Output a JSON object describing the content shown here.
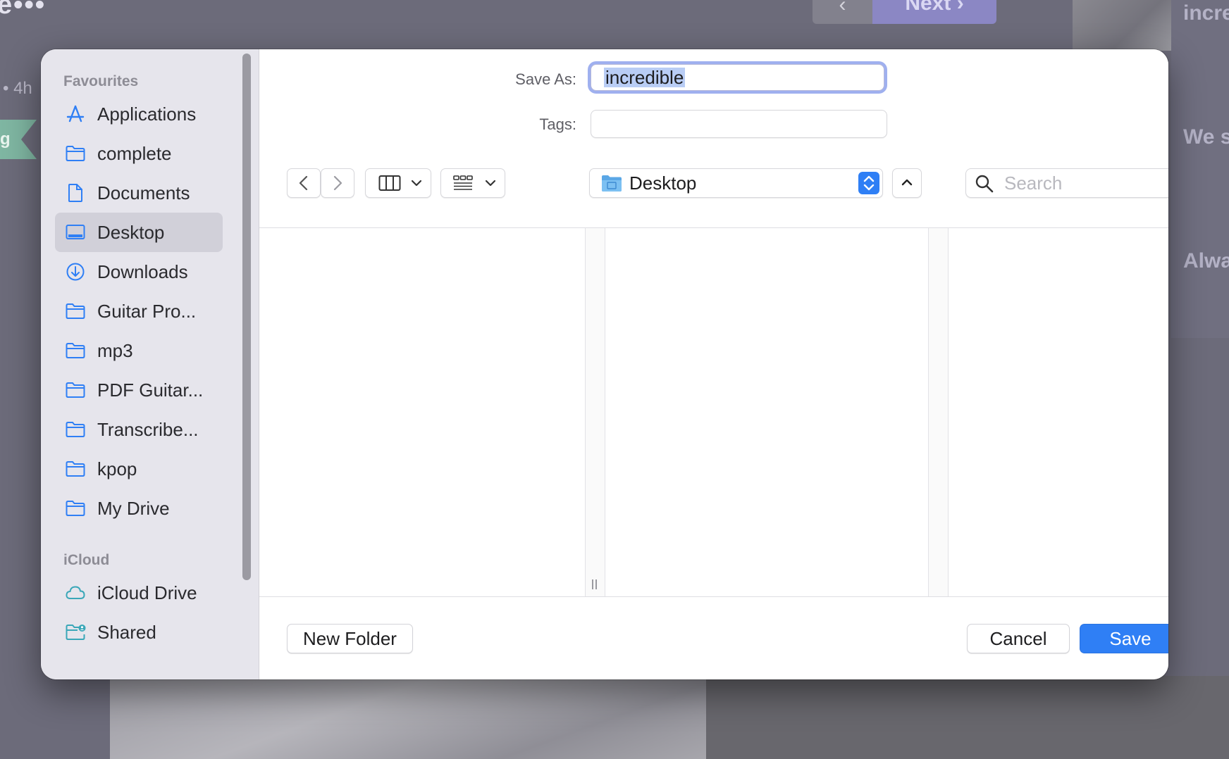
{
  "background": {
    "time_text": "• 4h",
    "tag_text": "g",
    "prev_arrow": "‹",
    "next_label": "Next",
    "next_arrow": "›",
    "right_texts": [
      "incre",
      "We s",
      "Alwa"
    ],
    "dots": "e•••"
  },
  "sidebar": {
    "favourites_heading": "Favourites",
    "favourites": [
      {
        "label": "Applications",
        "icon": "applications-icon"
      },
      {
        "label": "complete",
        "icon": "folder-icon"
      },
      {
        "label": "Documents",
        "icon": "document-icon"
      },
      {
        "label": "Desktop",
        "icon": "desktop-icon",
        "selected": true
      },
      {
        "label": "Downloads",
        "icon": "download-icon"
      },
      {
        "label": "Guitar Pro...",
        "icon": "folder-icon"
      },
      {
        "label": "mp3",
        "icon": "folder-icon"
      },
      {
        "label": "PDF Guitar...",
        "icon": "folder-icon"
      },
      {
        "label": "Transcribe...",
        "icon": "folder-icon"
      },
      {
        "label": "kpop",
        "icon": "folder-icon"
      },
      {
        "label": "My Drive",
        "icon": "folder-icon"
      }
    ],
    "icloud_heading": "iCloud",
    "icloud": [
      {
        "label": "iCloud Drive",
        "icon": "cloud-icon"
      },
      {
        "label": "Shared",
        "icon": "shared-folder-icon"
      }
    ]
  },
  "form": {
    "save_as_label": "Save As:",
    "save_as_value": "incredible",
    "tags_label": "Tags:",
    "tags_value": ""
  },
  "toolbar": {
    "location": "Desktop",
    "search_placeholder": "Search"
  },
  "footer": {
    "new_folder": "New Folder",
    "cancel": "Cancel",
    "save": "Save"
  },
  "colors": {
    "accent": "#2f7ff5",
    "sidebar_bg": "#e6e5ec",
    "selection": "#d1d0d9",
    "icon_blue": "#2f7ff5"
  }
}
